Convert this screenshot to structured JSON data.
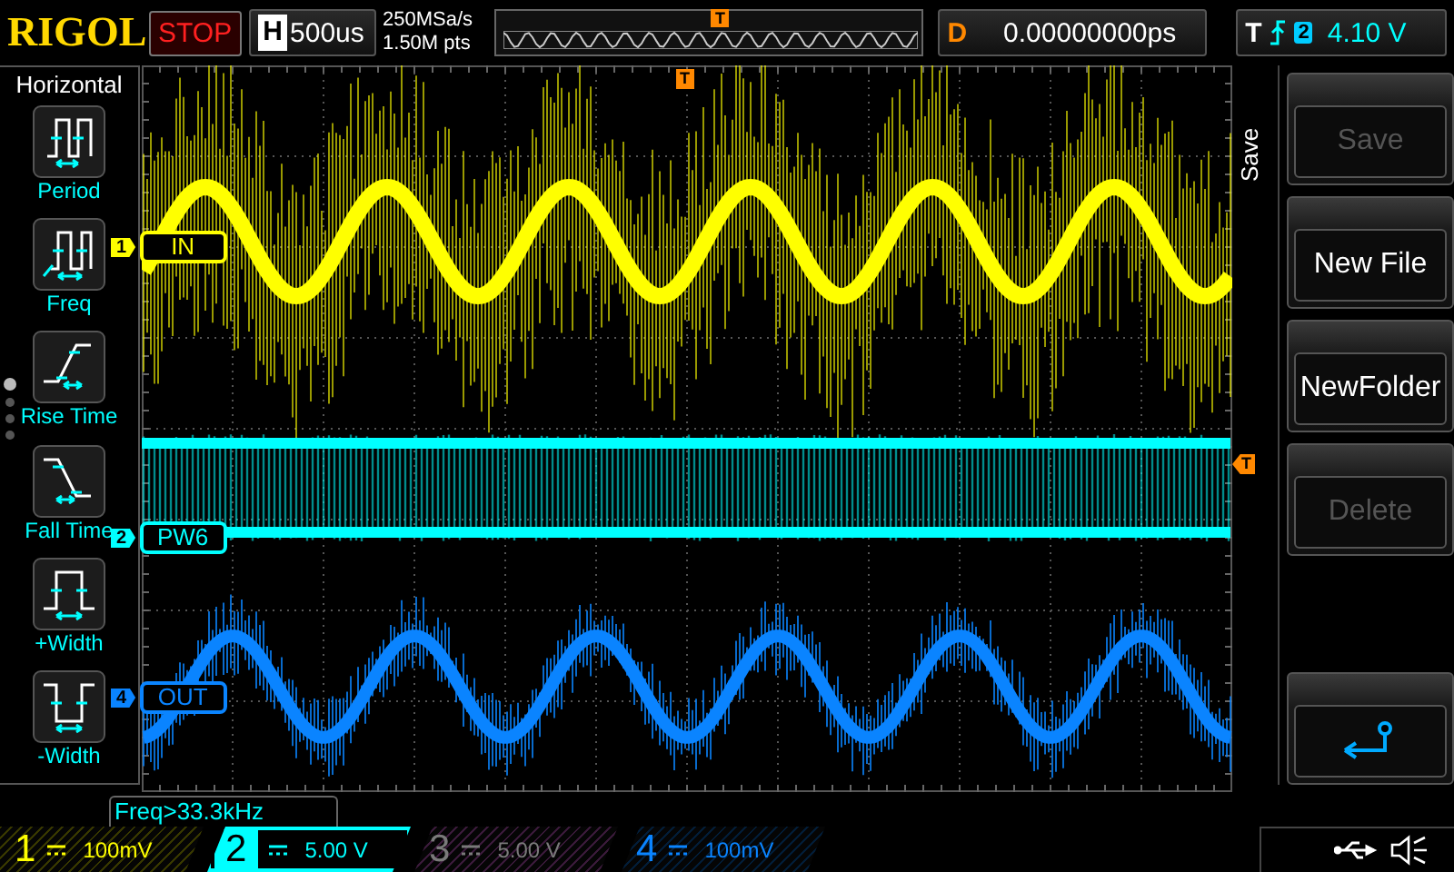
{
  "top_bar": {
    "logo": "RIGOL",
    "run_state": "STOP",
    "timebase": {
      "label": "H",
      "value": "500us"
    },
    "sample_rate": "250MSa/s",
    "memory_depth": "1.50M pts",
    "memory_trigger_marker": "T",
    "delay": {
      "label": "D",
      "value": "0.00000000ps"
    },
    "trigger": {
      "label": "T",
      "source": "2",
      "level": "4.10 V"
    }
  },
  "left_menu": {
    "title": "Horizontal",
    "items": [
      {
        "kind": "period",
        "label": "Period"
      },
      {
        "kind": "freq",
        "label": "Freq"
      },
      {
        "kind": "rise",
        "label": "Rise Time"
      },
      {
        "kind": "fall",
        "label": "Fall Time"
      },
      {
        "kind": "pwidth",
        "label": "+Width"
      },
      {
        "kind": "nwidth",
        "label": "-Width"
      }
    ],
    "pages": [
      {
        "selected": true
      },
      {
        "selected": false
      },
      {
        "selected": false
      },
      {
        "selected": false
      }
    ]
  },
  "grid_markers": {
    "trigger_time": "T",
    "trigger_level": "T"
  },
  "channels": [
    {
      "number": "1",
      "marker_number": "1",
      "label": "IN",
      "scale": "100mV",
      "color": "#ffff00",
      "on": true,
      "selected": false
    },
    {
      "number": "2",
      "marker_number": "2",
      "label": "PW6",
      "scale": "5.00 V",
      "color": "#00ffff",
      "on": true,
      "selected": true
    },
    {
      "number": "3",
      "scale": "5.00 V",
      "color": "#7a7a7a",
      "on": false,
      "selected": false
    },
    {
      "number": "4",
      "marker_number": "4",
      "label": "OUT",
      "scale": "100mV",
      "color": "#0a84ff",
      "on": true,
      "selected": false
    }
  ],
  "right_menu": {
    "title": "Save",
    "buttons": [
      {
        "kind": "text",
        "label": "Save",
        "disabled": true
      },
      {
        "kind": "text",
        "label": "New File",
        "disabled": false
      },
      {
        "kind": "text",
        "label": "NewFolder",
        "disabled": false
      },
      {
        "kind": "text",
        "label": "Delete",
        "disabled": true
      },
      {
        "kind": "back"
      }
    ]
  },
  "measurement": "Freq>33.3kHz"
}
